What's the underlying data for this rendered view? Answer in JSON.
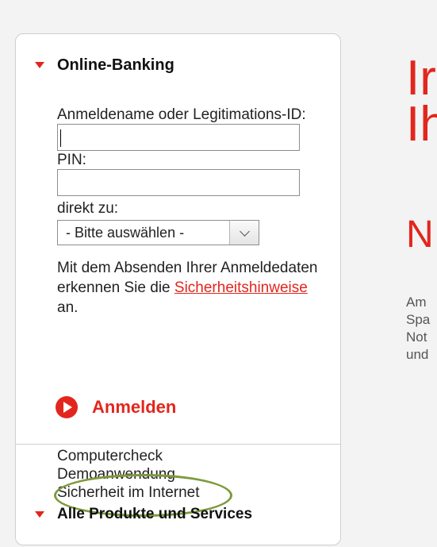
{
  "panel": {
    "online_banking": {
      "title": "Online-Banking"
    },
    "form": {
      "username_label": "Anmeldename oder Legitimations-ID:",
      "pin_label": "PIN:",
      "goto_label": "direkt zu:",
      "select_value": "- Bitte auswählen -"
    },
    "info": {
      "before": "Mit dem Absenden Ihrer Anmeldedaten erkennen Sie die ",
      "link": "Sicherheitshinweise",
      "after": " an."
    },
    "login_label": "Anmelden",
    "links": [
      "Computercheck",
      "Demoanwendung",
      "Sicherheit im Internet"
    ],
    "products": {
      "title": "Alle Produkte und Services"
    }
  },
  "main": {
    "heading_line1": "Ir",
    "heading_line2": "Ih",
    "subheading": "N",
    "text_lines": [
      "Am",
      "Spa",
      "Not",
      "und"
    ]
  },
  "colors": {
    "accent": "#e2261d",
    "highlight": "#7e9a3c"
  }
}
